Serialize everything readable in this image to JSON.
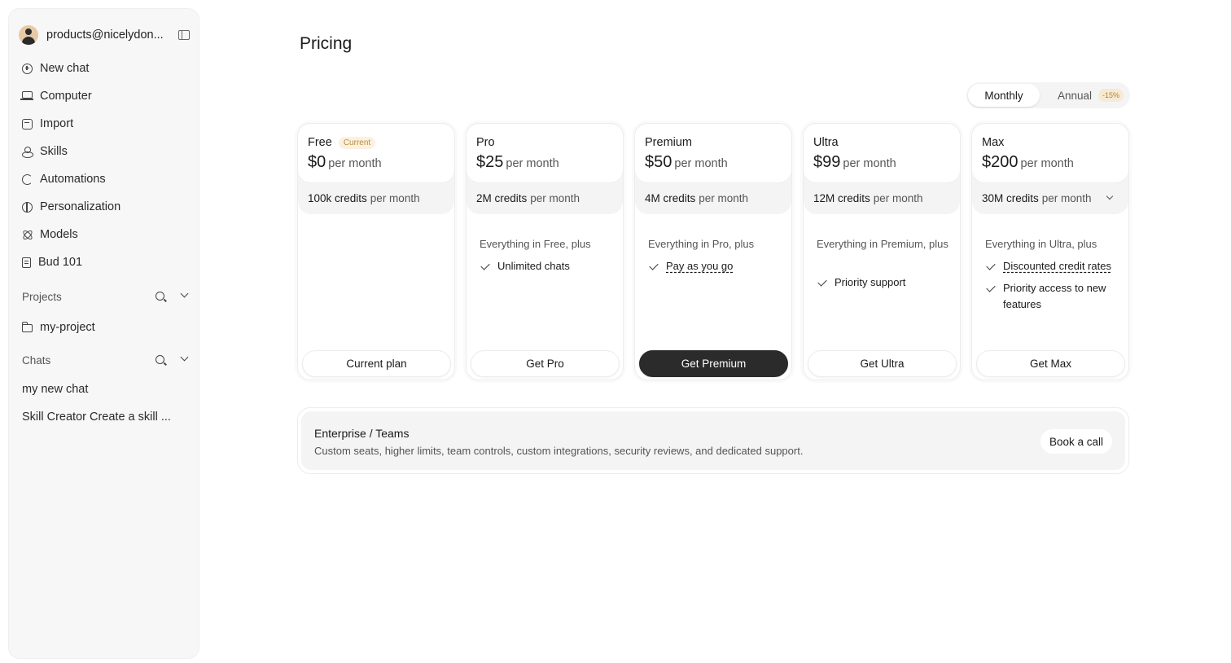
{
  "sidebar": {
    "account": "products@nicelydon...",
    "nav": [
      {
        "label": "New chat",
        "icon": "plus-circle-icon"
      },
      {
        "label": "Computer",
        "icon": "laptop-icon"
      },
      {
        "label": "Import",
        "icon": "import-icon"
      },
      {
        "label": "Skills",
        "icon": "skills-icon"
      },
      {
        "label": "Automations",
        "icon": "automations-icon"
      },
      {
        "label": "Personalization",
        "icon": "personalization-icon"
      },
      {
        "label": "Models",
        "icon": "models-icon"
      },
      {
        "label": "Bud 101",
        "icon": "book-icon"
      }
    ],
    "projects_label": "Projects",
    "projects": [
      "my-project"
    ],
    "chats_label": "Chats",
    "chats": [
      "my new chat",
      "Skill Creator Create a skill ..."
    ]
  },
  "main": {
    "title": "Pricing",
    "billing": {
      "monthly": "Monthly",
      "annual": "Annual",
      "discount": "-15%"
    },
    "plans": [
      {
        "name": "Free",
        "badge": "Current",
        "price": "$0",
        "per": "per month",
        "credits": "100k credits",
        "credits_per": "per month",
        "intro": "",
        "features": [],
        "button": "Current plan"
      },
      {
        "name": "Pro",
        "price": "$25",
        "per": "per month",
        "credits": "2M credits",
        "credits_per": "per month",
        "intro": "Everything in Free, plus",
        "features": [
          "Unlimited chats"
        ],
        "button": "Get Pro"
      },
      {
        "name": "Premium",
        "price": "$50",
        "per": "per month",
        "credits": "4M credits",
        "credits_per": "per month",
        "intro": "Everything in Pro, plus",
        "features": [
          "Pay as you go"
        ],
        "button": "Get Premium"
      },
      {
        "name": "Ultra",
        "price": "$99",
        "per": "per month",
        "credits": "12M credits",
        "credits_per": "per month",
        "intro": "Everything in Premium, plus",
        "features": [
          "Priority support"
        ],
        "button": "Get Ultra"
      },
      {
        "name": "Max",
        "price": "$200",
        "per": "per month",
        "credits": "30M credits",
        "credits_per": "per month",
        "intro": "Everything in Ultra, plus",
        "features": [
          "Discounted credit rates",
          "Priority access to new features"
        ],
        "button": "Get Max"
      }
    ],
    "enterprise": {
      "title": "Enterprise / Teams",
      "description": "Custom seats, higher limits, team controls, custom integrations, security reviews, and dedicated support.",
      "button": "Book a call"
    }
  }
}
